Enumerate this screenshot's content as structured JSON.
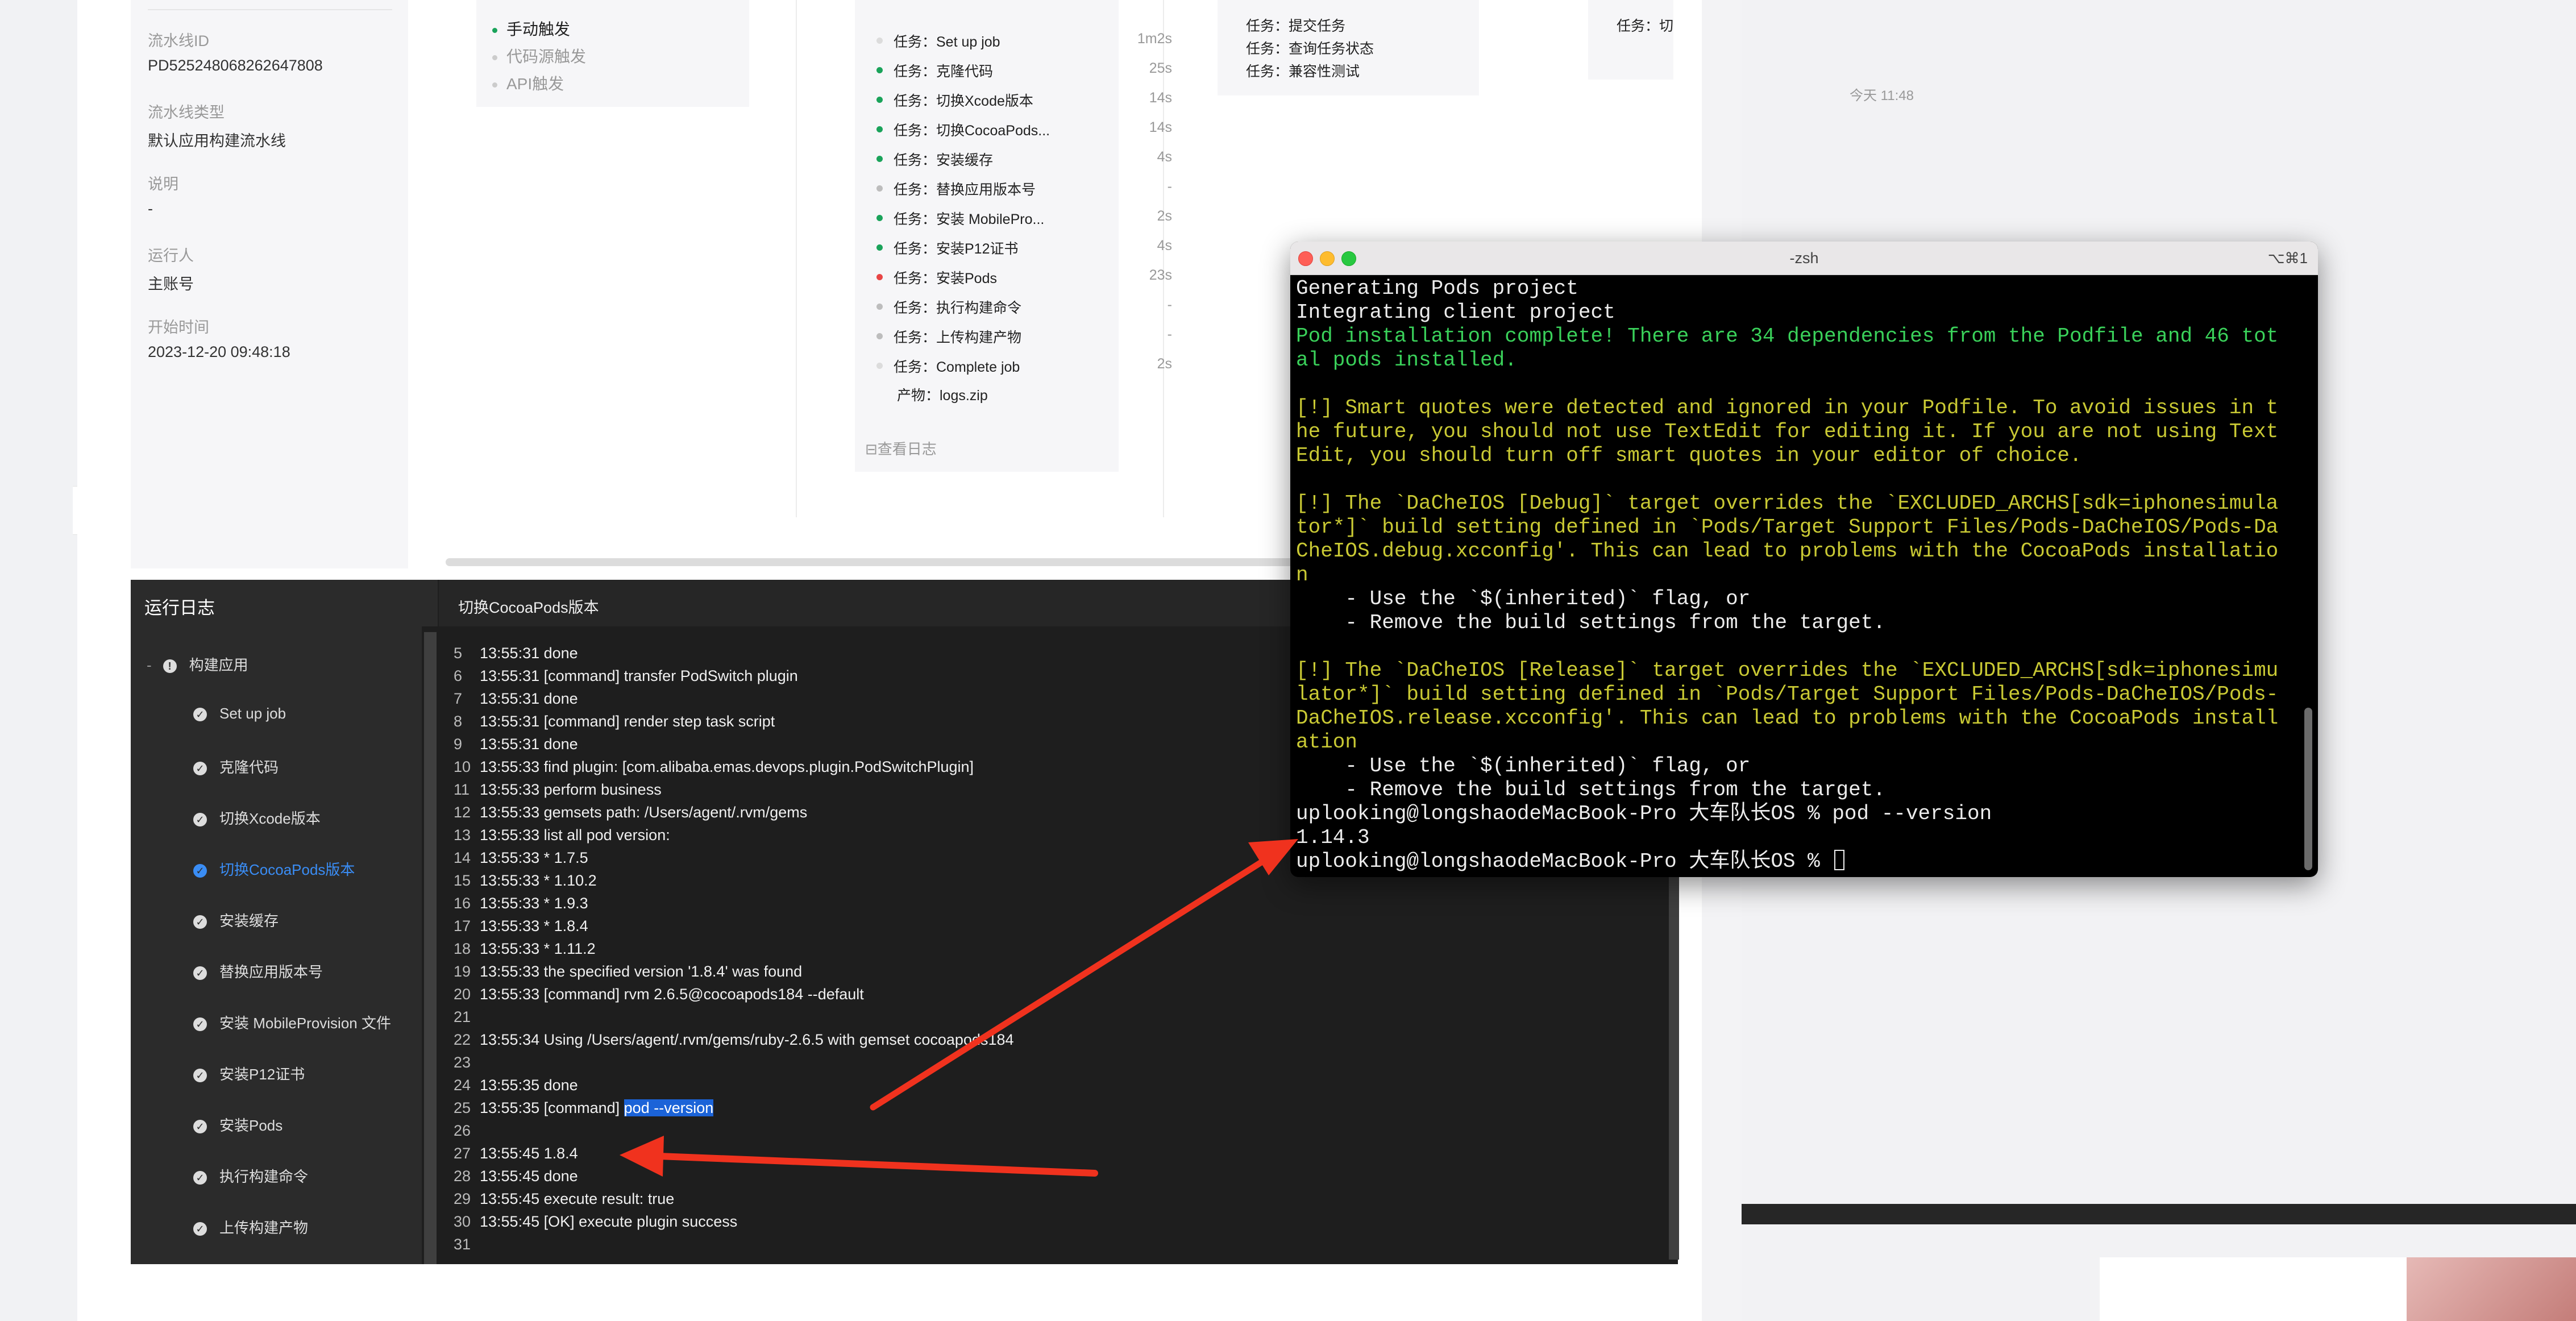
{
  "info": [
    {
      "label": "流水线ID",
      "value": "PD525248068262647808"
    },
    {
      "label": "流水线类型",
      "value": "默认应用构建流水线"
    },
    {
      "label": "说明",
      "value": "-"
    },
    {
      "label": "运行人",
      "value": "主账号"
    },
    {
      "label": "开始时间",
      "value": "2023-12-20 09:48:18"
    }
  ],
  "triggers": [
    "手动触发",
    "代码源触发",
    "API触发"
  ],
  "build_tasks": [
    {
      "name": "任务：Set up job",
      "duration": "1m2s",
      "status": "light"
    },
    {
      "name": "任务：克隆代码",
      "duration": "25s",
      "status": "success"
    },
    {
      "name": "任务：切换Xcode版本",
      "duration": "14s",
      "status": "success"
    },
    {
      "name": "任务：切换CocoaPods...",
      "duration": "14s",
      "status": "success"
    },
    {
      "name": "任务：安装缓存",
      "duration": "4s",
      "status": "success"
    },
    {
      "name": "任务：替换应用版本号",
      "duration": "-",
      "status": "skipped"
    },
    {
      "name": "任务：安装 MobilePro...",
      "duration": "2s",
      "status": "success"
    },
    {
      "name": "任务：安装P12证书",
      "duration": "4s",
      "status": "success"
    },
    {
      "name": "任务：安装Pods",
      "duration": "23s",
      "status": "failed"
    },
    {
      "name": "任务：执行构建命令",
      "duration": "-",
      "status": "skipped"
    },
    {
      "name": "任务：上传构建产物",
      "duration": "-",
      "status": "skipped"
    },
    {
      "name": "任务：Complete job",
      "duration": "2s",
      "status": "light"
    }
  ],
  "artifact": "产物：logs.zip",
  "view_log": "⊟查看日志",
  "test_tasks": [
    "任务：提交任务",
    "任务：查询任务状态",
    "任务：兼容性测试"
  ],
  "cut_task": "任务：切",
  "right_time": "今天 11:48",
  "log": {
    "title": "运行日志",
    "step_title": "切换CocoaPods版本",
    "tree_root": "构建应用",
    "tree_items": [
      "Set up job",
      "克隆代码",
      "切换Xcode版本",
      "切换CocoaPods版本",
      "安装缓存",
      "替换应用版本号",
      "安装 MobileProvision 文件",
      "安装P12证书",
      "安装Pods",
      "执行构建命令",
      "上传构建产物"
    ],
    "active_index": 3,
    "lines": [
      {
        "n": "5",
        "t": "13:55:31 done"
      },
      {
        "n": "6",
        "t": "13:55:31 [command] transfer PodSwitch plugin"
      },
      {
        "n": "7",
        "t": "13:55:31 done"
      },
      {
        "n": "8",
        "t": "13:55:31 [command] render step task script"
      },
      {
        "n": "9",
        "t": "13:55:31 done"
      },
      {
        "n": "10",
        "t": "13:55:33 find plugin: [com.alibaba.emas.devops.plugin.PodSwitchPlugin]"
      },
      {
        "n": "11",
        "t": "13:55:33 perform business"
      },
      {
        "n": "12",
        "t": "13:55:33 gemsets path: /Users/agent/.rvm/gems"
      },
      {
        "n": "13",
        "t": "13:55:33 list all pod version:"
      },
      {
        "n": "14",
        "t": "13:55:33 * 1.7.5"
      },
      {
        "n": "15",
        "t": "13:55:33 * 1.10.2"
      },
      {
        "n": "16",
        "t": "13:55:33 * 1.9.3"
      },
      {
        "n": "17",
        "t": "13:55:33 * 1.8.4"
      },
      {
        "n": "18",
        "t": "13:55:33 * 1.11.2"
      },
      {
        "n": "19",
        "t": "13:55:33 the specified version '1.8.4' was found"
      },
      {
        "n": "20",
        "t": "13:55:33 [command] rvm 2.6.5@cocoapods184 --default"
      },
      {
        "n": "21",
        "t": ""
      },
      {
        "n": "22",
        "t": "13:55:34 Using /Users/agent/.rvm/gems/ruby-2.6.5 with gemset cocoapods184"
      },
      {
        "n": "23",
        "t": ""
      },
      {
        "n": "24",
        "t": "13:55:35 done"
      },
      {
        "n": "25",
        "t": "13:55:35 [command] ",
        "hl": "pod --version"
      },
      {
        "n": "26",
        "t": ""
      },
      {
        "n": "27",
        "t": "13:55:45 1.8.4"
      },
      {
        "n": "28",
        "t": "13:55:45 done"
      },
      {
        "n": "29",
        "t": "13:55:45 execute result: true"
      },
      {
        "n": "30",
        "t": "13:55:45 [OK] execute plugin success"
      },
      {
        "n": "31",
        "t": ""
      }
    ]
  },
  "terminal": {
    "title": "-zsh",
    "shortcut": "⌥⌘1",
    "lines": [
      {
        "c": "w",
        "t": "Generating Pods project"
      },
      {
        "c": "w",
        "t": "Integrating client project"
      },
      {
        "c": "green",
        "t": "Pod installation complete! There are 34 dependencies from the Podfile and 46 tot"
      },
      {
        "c": "green",
        "t": "al pods installed."
      },
      {
        "c": "w",
        "t": ""
      },
      {
        "c": "yellow",
        "t": "[!] Smart quotes were detected and ignored in your Podfile. To avoid issues in t"
      },
      {
        "c": "yellow",
        "t": "he future, you should not use TextEdit for editing it. If you are not using Text"
      },
      {
        "c": "yellow",
        "t": "Edit, you should turn off smart quotes in your editor of choice."
      },
      {
        "c": "w",
        "t": ""
      },
      {
        "c": "yellow",
        "t": "[!] The `DaCheIOS [Debug]` target overrides the `EXCLUDED_ARCHS[sdk=iphonesimula"
      },
      {
        "c": "yellow",
        "t": "tor*]` build setting defined in `Pods/Target Support Files/Pods-DaCheIOS/Pods-Da"
      },
      {
        "c": "yellow",
        "t": "CheIOS.debug.xcconfig'. This can lead to problems with the CocoaPods installatio"
      },
      {
        "c": "yellow",
        "t": "n"
      },
      {
        "c": "w",
        "t": "    - Use the `$(inherited)` flag, or"
      },
      {
        "c": "w",
        "t": "    - Remove the build settings from the target."
      },
      {
        "c": "w",
        "t": ""
      },
      {
        "c": "yellow",
        "t": "[!] The `DaCheIOS [Release]` target overrides the `EXCLUDED_ARCHS[sdk=iphonesimu"
      },
      {
        "c": "yellow",
        "t": "lator*]` build setting defined in `Pods/Target Support Files/Pods-DaCheIOS/Pods-"
      },
      {
        "c": "yellow",
        "t": "DaCheIOS.release.xcconfig'. This can lead to problems with the CocoaPods install"
      },
      {
        "c": "yellow",
        "t": "ation"
      },
      {
        "c": "w",
        "t": "    - Use the `$(inherited)` flag, or"
      },
      {
        "c": "w",
        "t": "    - Remove the build settings from the target."
      },
      {
        "c": "w",
        "t": "uplooking@longshaodeMacBook-Pro 大车队长OS % pod --version"
      },
      {
        "c": "w",
        "t": "1.14.3"
      },
      {
        "c": "w",
        "t": "uplooking@longshaodeMacBook-Pro 大车队长OS % ",
        "cursor": true
      }
    ]
  },
  "colors": {
    "success": "#1aa35a",
    "failed": "#e84545",
    "active": "#3a8df5",
    "arrow": "#f0321e"
  }
}
